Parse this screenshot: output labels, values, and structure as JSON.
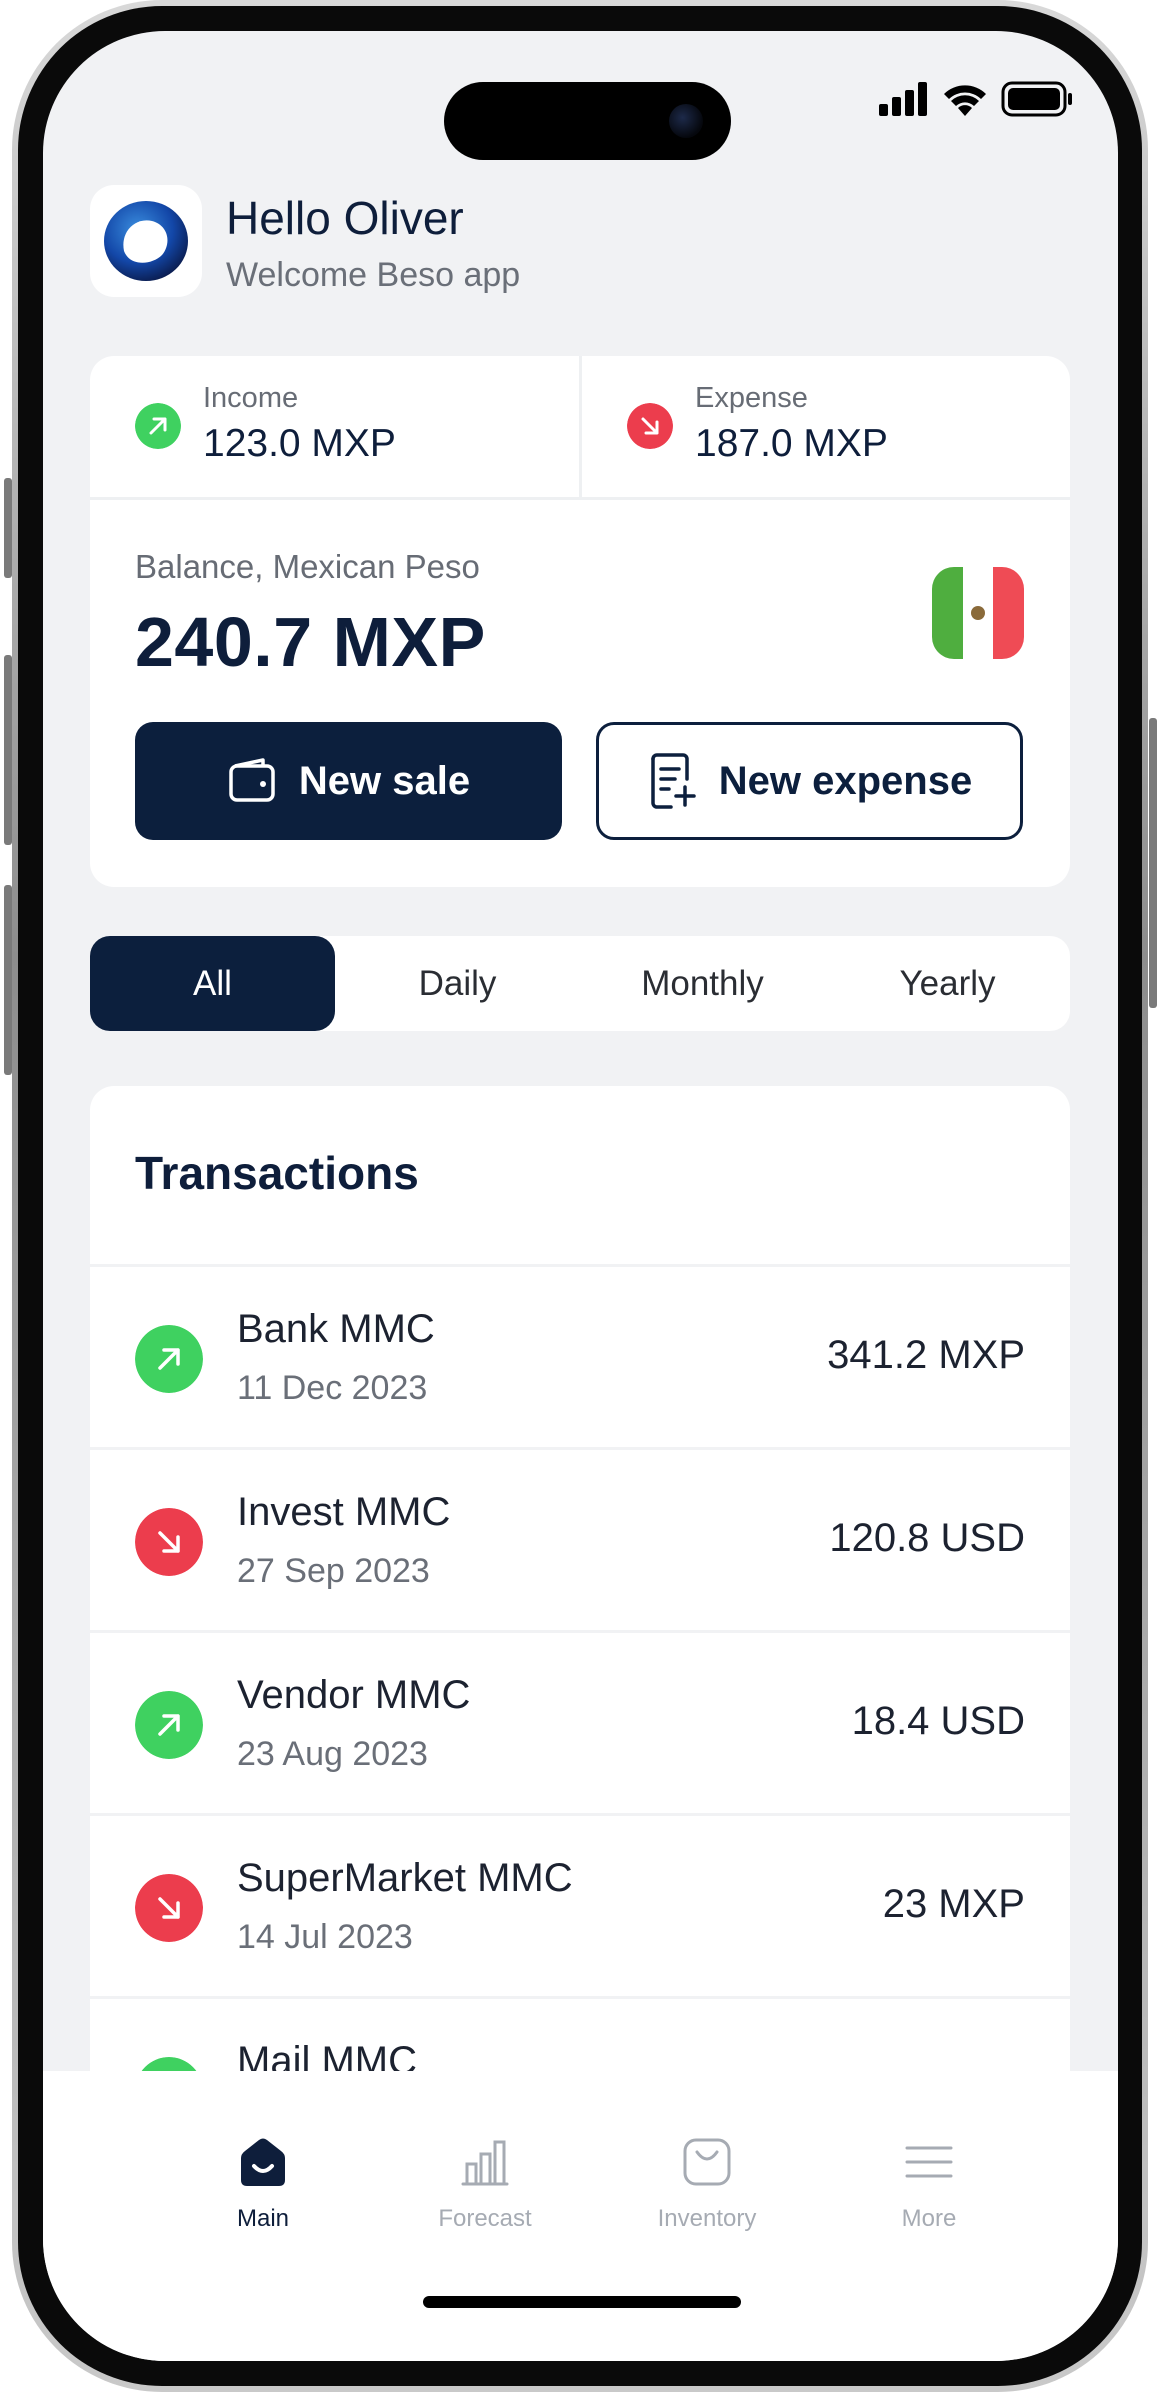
{
  "header": {
    "greeting": "Hello Oliver",
    "subtitle": "Welcome Beso app",
    "logo_icon": "beso-logo-icon"
  },
  "summary": {
    "income_label": "Income",
    "income_value": "123.0 MXP",
    "expense_label": "Expense",
    "expense_value": "187.0 MXP",
    "balance_label": "Balance, Mexican Peso",
    "balance_value": "240.7 MXP",
    "flag_icon": "mexico-flag-icon",
    "new_sale_label": "New sale",
    "new_expense_label": "New expense"
  },
  "filters": {
    "tabs": [
      "All",
      "Daily",
      "Monthly",
      "Yearly"
    ],
    "selected": "All"
  },
  "transactions": {
    "title": "Transactions",
    "items": [
      {
        "name": "Bank MMC",
        "date": "11 Dec 2023",
        "amount": "341.2 MXP",
        "direction": "income"
      },
      {
        "name": "Invest MMC",
        "date": "27 Sep 2023",
        "amount": "120.8 USD",
        "direction": "expense"
      },
      {
        "name": "Vendor MMC",
        "date": "23 Aug 2023",
        "amount": "18.4 USD",
        "direction": "income"
      },
      {
        "name": "SuperMarket MMC",
        "date": "14 Jul 2023",
        "amount": "23 MXP",
        "direction": "expense"
      },
      {
        "name": "Mail MMC",
        "date": "",
        "amount": "",
        "direction": "income"
      }
    ]
  },
  "nav": {
    "items": [
      {
        "label": "Main",
        "icon": "home-icon",
        "active": true
      },
      {
        "label": "Forecast",
        "icon": "bar-chart-icon",
        "active": false
      },
      {
        "label": "Inventory",
        "icon": "shopping-bag-icon",
        "active": false
      },
      {
        "label": "More",
        "icon": "menu-icon",
        "active": false
      }
    ]
  },
  "colors": {
    "primary": "#0c1f3d",
    "income": "#3fd160",
    "expense": "#ec3d4d",
    "background": "#f1f2f4"
  }
}
